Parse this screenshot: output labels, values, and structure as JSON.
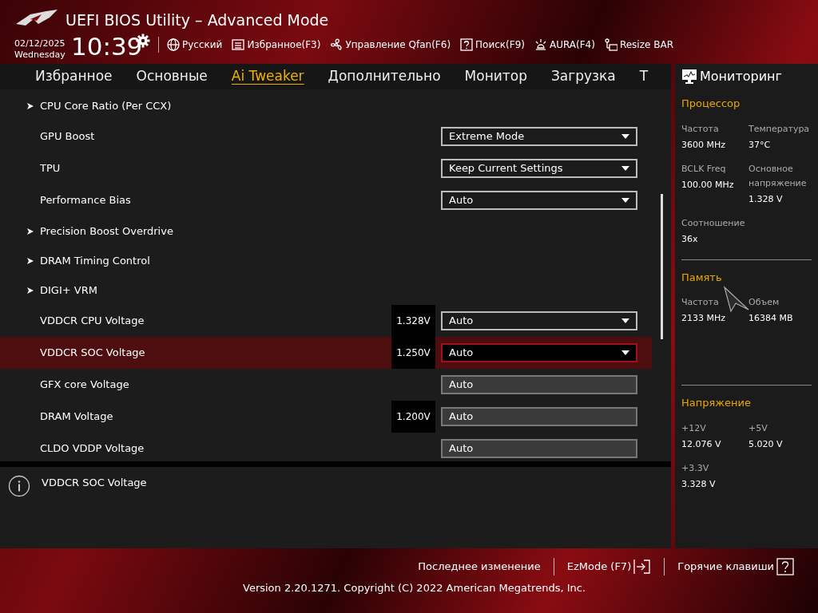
{
  "header": {
    "title": "UEFI BIOS Utility – Advanced Mode",
    "date": "02/12/2025",
    "weekday": "Wednesday",
    "time": "10:39",
    "tools": [
      {
        "kind": "globe",
        "label": "Русский"
      },
      {
        "kind": "list",
        "label": "Избранное(F3)"
      },
      {
        "kind": "fan",
        "label": "Управление Qfan(F6)"
      },
      {
        "kind": "help",
        "label": "Поиск(F9)"
      },
      {
        "kind": "aura",
        "label": "AURA(F4)"
      },
      {
        "kind": "resize",
        "label": "Resize BAR"
      }
    ]
  },
  "tabs": [
    {
      "label": "Избранное",
      "selected": false
    },
    {
      "label": "Основные",
      "selected": false
    },
    {
      "label": "Ai Tweaker",
      "selected": true
    },
    {
      "label": "Дополнительно",
      "selected": false
    },
    {
      "label": "Монитор",
      "selected": false
    },
    {
      "label": "Загрузка",
      "selected": false
    },
    {
      "label": "T",
      "selected": false
    }
  ],
  "settings": [
    {
      "kind": "submenu",
      "label": "CPU Core Ratio (Per CCX)",
      "selected": false
    },
    {
      "kind": "dropdown",
      "label": "GPU Boost",
      "value": "Extreme Mode",
      "selected": false
    },
    {
      "kind": "dropdown",
      "label": "TPU",
      "value": "Keep Current Settings",
      "selected": false
    },
    {
      "kind": "dropdown",
      "label": "Performance Bias",
      "value": "Auto",
      "selected": false
    },
    {
      "kind": "submenu",
      "label": "Precision Boost Overdrive",
      "selected": false
    },
    {
      "kind": "submenu",
      "label": "DRAM Timing Control",
      "selected": false
    },
    {
      "kind": "submenu",
      "label": "DIGI+ VRM",
      "selected": false
    },
    {
      "kind": "dropdown",
      "label": "VDDCR CPU Voltage",
      "reading": "1.328V",
      "value": "Auto",
      "selected": false
    },
    {
      "kind": "dropdown",
      "label": "VDDCR SOC Voltage",
      "reading": "1.250V",
      "value": "Auto",
      "selected": true
    },
    {
      "kind": "fixed",
      "label": "GFX core Voltage",
      "value": "Auto",
      "selected": false
    },
    {
      "kind": "fixed",
      "label": "DRAM Voltage",
      "reading": "1.200V",
      "value": "Auto",
      "selected": false
    },
    {
      "kind": "fixed",
      "label": "CLDO VDDP Voltage",
      "value": "Auto",
      "selected": false
    }
  ],
  "help": {
    "text": "VDDCR SOC Voltage"
  },
  "monitor": {
    "title": "Мониторинг",
    "sections": [
      {
        "title": "Процессор",
        "items": [
          {
            "label": "Частота",
            "value": "3600 MHz"
          },
          {
            "label": "Температура",
            "value": "37°C"
          },
          {
            "label": "BCLK Freq",
            "value": "100.00 MHz"
          },
          {
            "label": "Основное напряжение",
            "value": "1.328 V"
          },
          {
            "label": "Соотношение",
            "value": "36x"
          }
        ]
      },
      {
        "title": "Память",
        "items": [
          {
            "label": "Частота",
            "value": "2133 MHz"
          },
          {
            "label": "Объем",
            "value": "16384 MB"
          }
        ]
      },
      {
        "title": "Напряжение",
        "items": [
          {
            "label": "+12V",
            "value": "12.076 V"
          },
          {
            "label": "+5V",
            "value": "5.020 V"
          },
          {
            "label": "+3.3V",
            "value": "3.328 V"
          }
        ]
      }
    ]
  },
  "footer": {
    "actions": [
      {
        "kind": "plain",
        "label": "Последнее изменение"
      },
      {
        "kind": "exit",
        "label": "EzMode (F7)"
      },
      {
        "kind": "help",
        "label": "Горячие клавиши"
      }
    ],
    "version": "Version 2.20.1271. Copyright (C) 2022 American Megatrends, Inc."
  }
}
